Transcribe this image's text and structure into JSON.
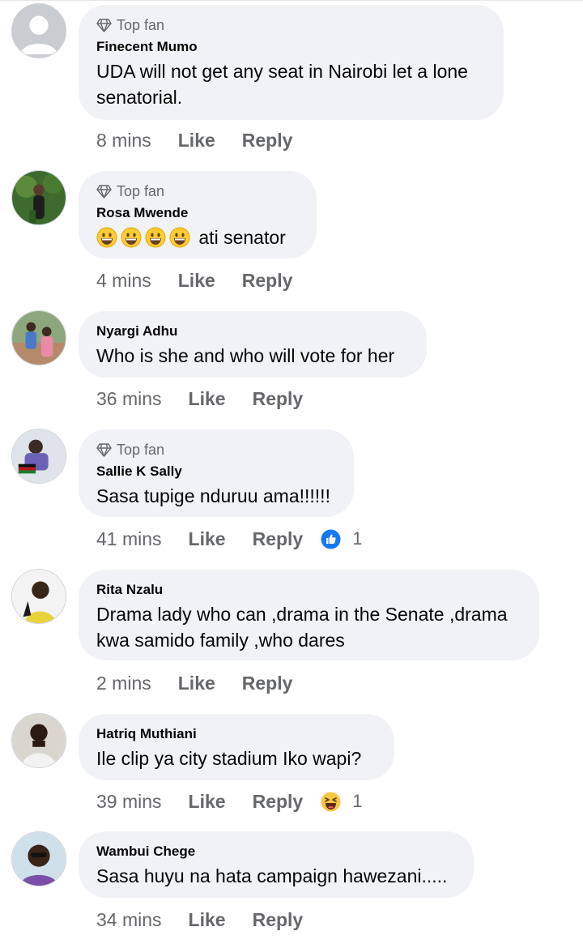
{
  "comments": [
    {
      "author": "Finecent Mumo",
      "badge": "Top fan",
      "text": "UDA will not get any seat in Nairobi let a lone senatorial.",
      "time": "8 mins",
      "like": "Like",
      "reply": "Reply"
    },
    {
      "author": "Rosa Mwende",
      "badge": "Top fan",
      "text": "ati senator",
      "time": "4 mins",
      "like": "Like",
      "reply": "Reply",
      "emojis": 4
    },
    {
      "author": "Nyargi Adhu",
      "text": "Who is she and who will vote for her",
      "time": "36 mins",
      "like": "Like",
      "reply": "Reply"
    },
    {
      "author": "Sallie K Sally",
      "badge": "Top fan",
      "text": "Sasa tupige nduruu ama!!!!!!",
      "time": "41 mins",
      "like": "Like",
      "reply": "Reply",
      "reaction": {
        "type": "like",
        "count": "1"
      }
    },
    {
      "author": "Rita Nzalu",
      "text": "Drama lady who can ,drama in the Senate ,drama kwa samido family ,who dares",
      "time": "2 mins",
      "like": "Like",
      "reply": "Reply"
    },
    {
      "author": "Hatriq Muthiani",
      "text": "Ile clip ya city stadium Iko wapi?",
      "time": "39 mins",
      "like": "Like",
      "reply": "Reply",
      "reaction": {
        "type": "haha",
        "count": "1"
      }
    },
    {
      "author": "Wambui Chege",
      "text": "Sasa huyu na hata campaign hawezani.....",
      "time": "34 mins",
      "like": "Like",
      "reply": "Reply"
    }
  ],
  "colors": {
    "bubble": "#f0f2f5",
    "meta": "#65676b",
    "text": "#050505",
    "like_blue": "#1877f2"
  }
}
